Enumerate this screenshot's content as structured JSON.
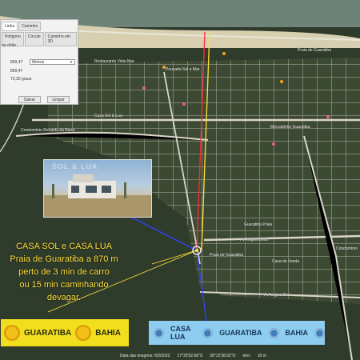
{
  "measure_panel": {
    "tabs": [
      "Linha",
      "Caminho",
      "Polígono",
      "Círculo",
      "Caminho em 3D"
    ],
    "ground_label": "no chão",
    "length_value": "859,47",
    "unit_selected": "Metros",
    "map_length_value": "859,47",
    "heading_value": "73,30 graus",
    "save_button": "Salvar",
    "clear_button": "Limpar"
  },
  "map_labels": {
    "beach_name": "Praia de Guaratiba",
    "place_1": "Restaurante Vista Mar",
    "place_2": "Pousada Sol e Mar",
    "place_3": "Casa Sol & Lua",
    "place_4": "Mercadinho Guaratiba",
    "place_5": "Condomínio Recanto da Barra",
    "place_6": "Guaratiba Praia",
    "street_1": "Av. Lagoa Doce",
    "street_2": "Av. Lagoa Doce",
    "street_3": "Praia de Guaratiba",
    "street_4": "Casa de Vanda",
    "condo_label": "Condomínio",
    "beach_label": "Praia de Guaratiba",
    "photo_title": "SOL & LUA"
  },
  "caption": {
    "line_1": "CASA SOL e CASA LUA",
    "line_2": "Praia de Guaratiba a 870 m",
    "line_3": "perto de 3 min de carro",
    "line_4": "ou 15 min caminhando",
    "line_5": "devagar."
  },
  "banner_yellow": {
    "text_1": "GUARATIBA",
    "text_2": "BAHIA"
  },
  "banner_blue": {
    "text_1": "CASA LUA",
    "text_2": "GUARATIBA",
    "text_3": "BAHIA"
  },
  "status_bar": {
    "imagery_date": "Data das imagens: 6/2/2022",
    "lat": "17°25'02.66\"S",
    "lon": "39°12'38.02\"O",
    "elev_label": "elev",
    "elev_value": "10 m"
  },
  "colors": {
    "measure_line": "#ffe23a",
    "red_line": "#ff2a3a",
    "blue_line": "#2a44ff",
    "pin_pink": "#f35a9a",
    "pin_orange": "#f2a21c",
    "caption_yellow": "#ffe040",
    "banner_yellow": "#f1df1e",
    "banner_blue": "#8fcdf0"
  },
  "icons": [
    "sun-icon",
    "emblem-icon",
    "dropdown-arrow-icon",
    "map-pin-icon"
  ]
}
